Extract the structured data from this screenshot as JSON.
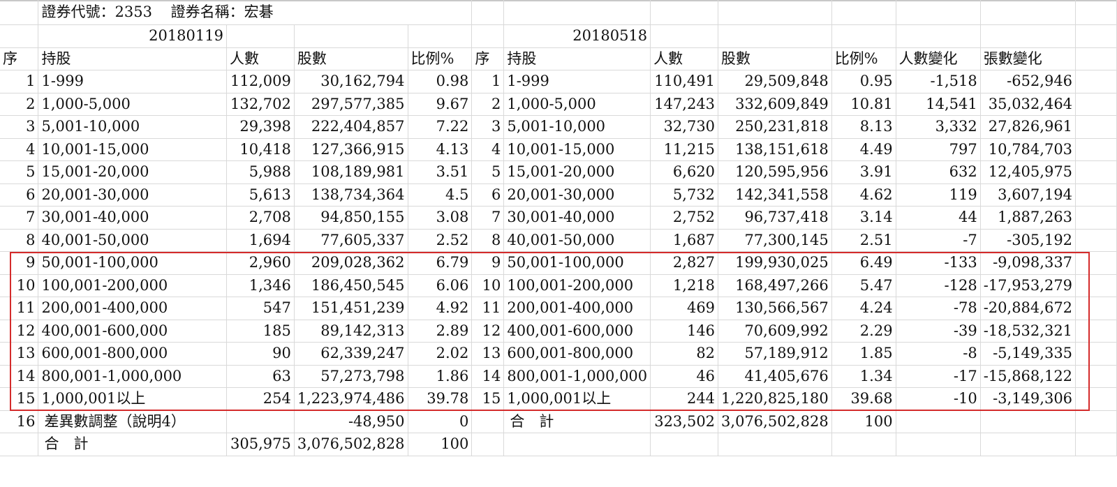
{
  "header": {
    "stock_info": "證券代號：2353    證券名稱：宏碁",
    "date_a": "20180119",
    "date_b": "20180518"
  },
  "columns": [
    "序",
    "持股",
    "人數",
    "股數",
    "比例%",
    "序",
    "持股",
    "人數",
    "股數",
    "比例%",
    "人數變化",
    "張數變化"
  ],
  "rows": [
    [
      "1",
      "1-999",
      "112,009",
      "30,162,794",
      "0.98",
      "1",
      "1-999",
      "110,491",
      "29,509,848",
      "0.95",
      "-1,518",
      "-652,946"
    ],
    [
      "2",
      "1,000-5,000",
      "132,702",
      "297,577,385",
      "9.67",
      "2",
      "1,000-5,000",
      "147,243",
      "332,609,849",
      "10.81",
      "14,541",
      "35,032,464"
    ],
    [
      "3",
      "5,001-10,000",
      "29,398",
      "222,404,857",
      "7.22",
      "3",
      "5,001-10,000",
      "32,730",
      "250,231,818",
      "8.13",
      "3,332",
      "27,826,961"
    ],
    [
      "4",
      "10,001-15,000",
      "10,418",
      "127,366,915",
      "4.13",
      "4",
      "10,001-15,000",
      "11,215",
      "138,151,618",
      "4.49",
      "797",
      "10,784,703"
    ],
    [
      "5",
      "15,001-20,000",
      "5,988",
      "108,189,981",
      "3.51",
      "5",
      "15,001-20,000",
      "6,620",
      "120,595,956",
      "3.91",
      "632",
      "12,405,975"
    ],
    [
      "6",
      "20,001-30,000",
      "5,613",
      "138,734,364",
      "4.5",
      "6",
      "20,001-30,000",
      "5,732",
      "142,341,558",
      "4.62",
      "119",
      "3,607,194"
    ],
    [
      "7",
      "30,001-40,000",
      "2,708",
      "94,850,155",
      "3.08",
      "7",
      "30,001-40,000",
      "2,752",
      "96,737,418",
      "3.14",
      "44",
      "1,887,263"
    ],
    [
      "8",
      "40,001-50,000",
      "1,694",
      "77,605,337",
      "2.52",
      "8",
      "40,001-50,000",
      "1,687",
      "77,300,145",
      "2.51",
      "-7",
      "-305,192"
    ],
    [
      "9",
      "50,001-100,000",
      "2,960",
      "209,028,362",
      "6.79",
      "9",
      "50,001-100,000",
      "2,827",
      "199,930,025",
      "6.49",
      "-133",
      "-9,098,337"
    ],
    [
      "10",
      "100,001-200,000",
      "1,346",
      "186,450,545",
      "6.06",
      "10",
      "100,001-200,000",
      "1,218",
      "168,497,266",
      "5.47",
      "-128",
      "-17,953,279"
    ],
    [
      "11",
      "200,001-400,000",
      "547",
      "151,451,239",
      "4.92",
      "11",
      "200,001-400,000",
      "469",
      "130,566,567",
      "4.24",
      "-78",
      "-20,884,672"
    ],
    [
      "12",
      "400,001-600,000",
      "185",
      "89,142,313",
      "2.89",
      "12",
      "400,001-600,000",
      "146",
      "70,609,992",
      "2.29",
      "-39",
      "-18,532,321"
    ],
    [
      "13",
      "600,001-800,000",
      "90",
      "62,339,247",
      "2.02",
      "13",
      "600,001-800,000",
      "82",
      "57,189,912",
      "1.85",
      "-8",
      "-5,149,335"
    ],
    [
      "14",
      "800,001-1,000,000",
      "63",
      "57,273,798",
      "1.86",
      "14",
      "800,001-1,000,000",
      "46",
      "41,405,676",
      "1.34",
      "-17",
      "-15,868,122"
    ],
    [
      "15",
      "1,000,001以上",
      "254",
      "1,223,974,486",
      "39.78",
      "15",
      "1,000,001以上",
      "244",
      "1,220,825,180",
      "39.68",
      "-10",
      "-3,149,306"
    ],
    [
      "16",
      "差異數調整（說明4）",
      "",
      "-48,950",
      "0",
      "",
      "合　計",
      "323,502",
      "3,076,502,828",
      "100",
      "",
      ""
    ],
    [
      "",
      "合　計",
      "305,975",
      "3,076,502,828",
      "100",
      "",
      "",
      "",
      "",
      "",
      "",
      ""
    ]
  ]
}
